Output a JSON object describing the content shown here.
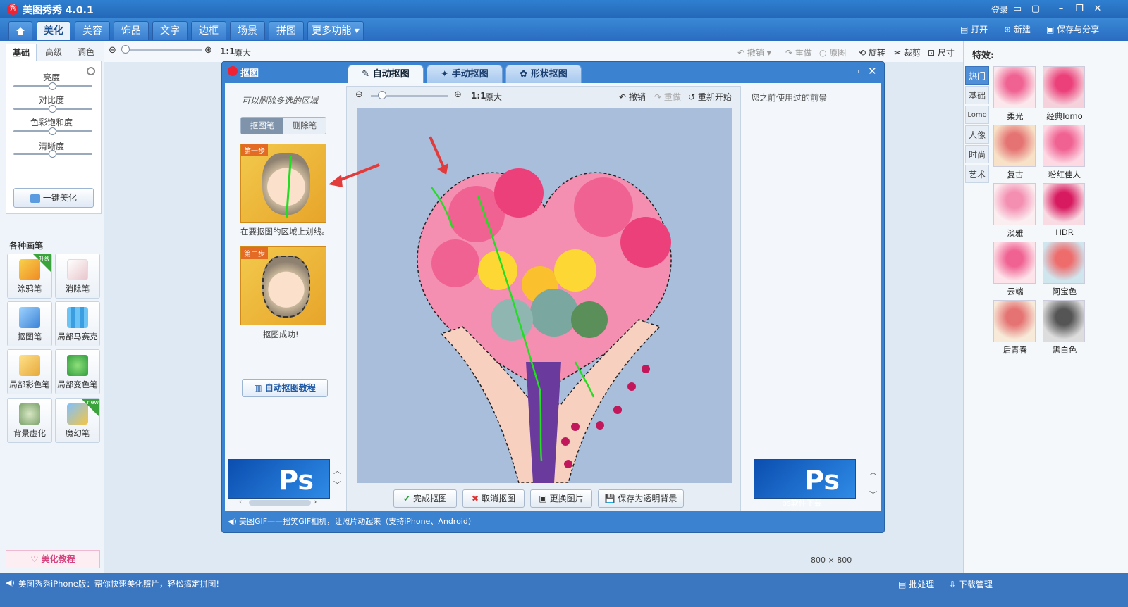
{
  "app": {
    "title": "美图秀秀 4.0.1",
    "login": "登录"
  },
  "menu": {
    "tabs": [
      "美化",
      "美容",
      "饰品",
      "文字",
      "边框",
      "场景",
      "拼图",
      "更多功能"
    ],
    "right_actions": [
      "打开",
      "新建",
      "保存与分享"
    ]
  },
  "left_panel": {
    "subtabs": [
      "基础",
      "高级",
      "调色"
    ],
    "sliders": [
      "亮度",
      "对比度",
      "色彩饱和度",
      "清晰度"
    ],
    "slider_levels": [
      0.5,
      0.5,
      0.5,
      0.5
    ],
    "onekey_label": "一键美化",
    "section_title": "各种画笔",
    "tools": [
      "涂鸦笔",
      "消除笔",
      "抠图笔",
      "局部马赛克",
      "局部彩色笔",
      "局部变色笔",
      "背景虚化",
      "魔幻笔"
    ],
    "badges": [
      "升级",
      "new"
    ],
    "tutorial_label": "美化教程"
  },
  "subtoolbar": {
    "zoom_label": "1:1",
    "zoom_suffix": "原大",
    "actions": [
      "撤销",
      "重做",
      "原图",
      "旋转",
      "裁剪",
      "尺寸"
    ]
  },
  "dialog": {
    "title": "抠图",
    "tabs": [
      "自动抠图",
      "手动抠图",
      "形状抠图"
    ],
    "hint": "可以删除多选的区域",
    "pen_tabs": [
      "抠图笔",
      "删除笔"
    ],
    "step1_label": "第一步",
    "step1_caption": "在要抠图的区域上划线。",
    "step2_label": "第二步",
    "step2_caption": "抠图成功!",
    "tutorial_link": "自动抠图教程",
    "canvas_zoom": "1:1",
    "canvas_zoom_suffix": "原大",
    "canvas_actions": [
      "撤销",
      "重做",
      "重新开始"
    ],
    "canvas_buttons": [
      "完成抠图",
      "取消抠图",
      "更换图片",
      "保存为透明背景"
    ],
    "right_note": "您之前使用过的前景",
    "ad_text": "Ps",
    "ad_subtext": "ps软件下载",
    "status": "美图GIF——摇笑GIF相机，让照片动起来（支持iPhone、Android）"
  },
  "effects": {
    "title": "特效:",
    "categories": [
      "热门",
      "基础",
      "Lomo",
      "人像",
      "时尚",
      "艺术"
    ],
    "items": [
      "柔光",
      "经典lomo",
      "复古",
      "粉红佳人",
      "淡雅",
      "HDR",
      "云端",
      "阿宝色",
      "后青春",
      "黑白色"
    ]
  },
  "canvas_info": {
    "size": "800 × 800"
  },
  "statusbar": {
    "message": "美图秀秀iPhone版：帮你快速美化照片，轻松搞定拼图!",
    "actions": [
      "批处理",
      "下载管理"
    ]
  },
  "colors": {
    "titlebar": "#2f7fd0",
    "dialog_frame": "#3b82d0",
    "canvas_bg": "#a9bedb",
    "accent_pink": "#d4457f",
    "path_green": "#22dd22",
    "arrow_red": "#e23b3b"
  },
  "icons": [
    "home-icon",
    "zoom-out-icon",
    "zoom-in-icon",
    "undo-icon",
    "redo-icon",
    "rotate-icon",
    "crop-icon",
    "resize-icon",
    "check-icon",
    "cancel-icon",
    "image-icon",
    "save-icon",
    "speaker-icon"
  ]
}
